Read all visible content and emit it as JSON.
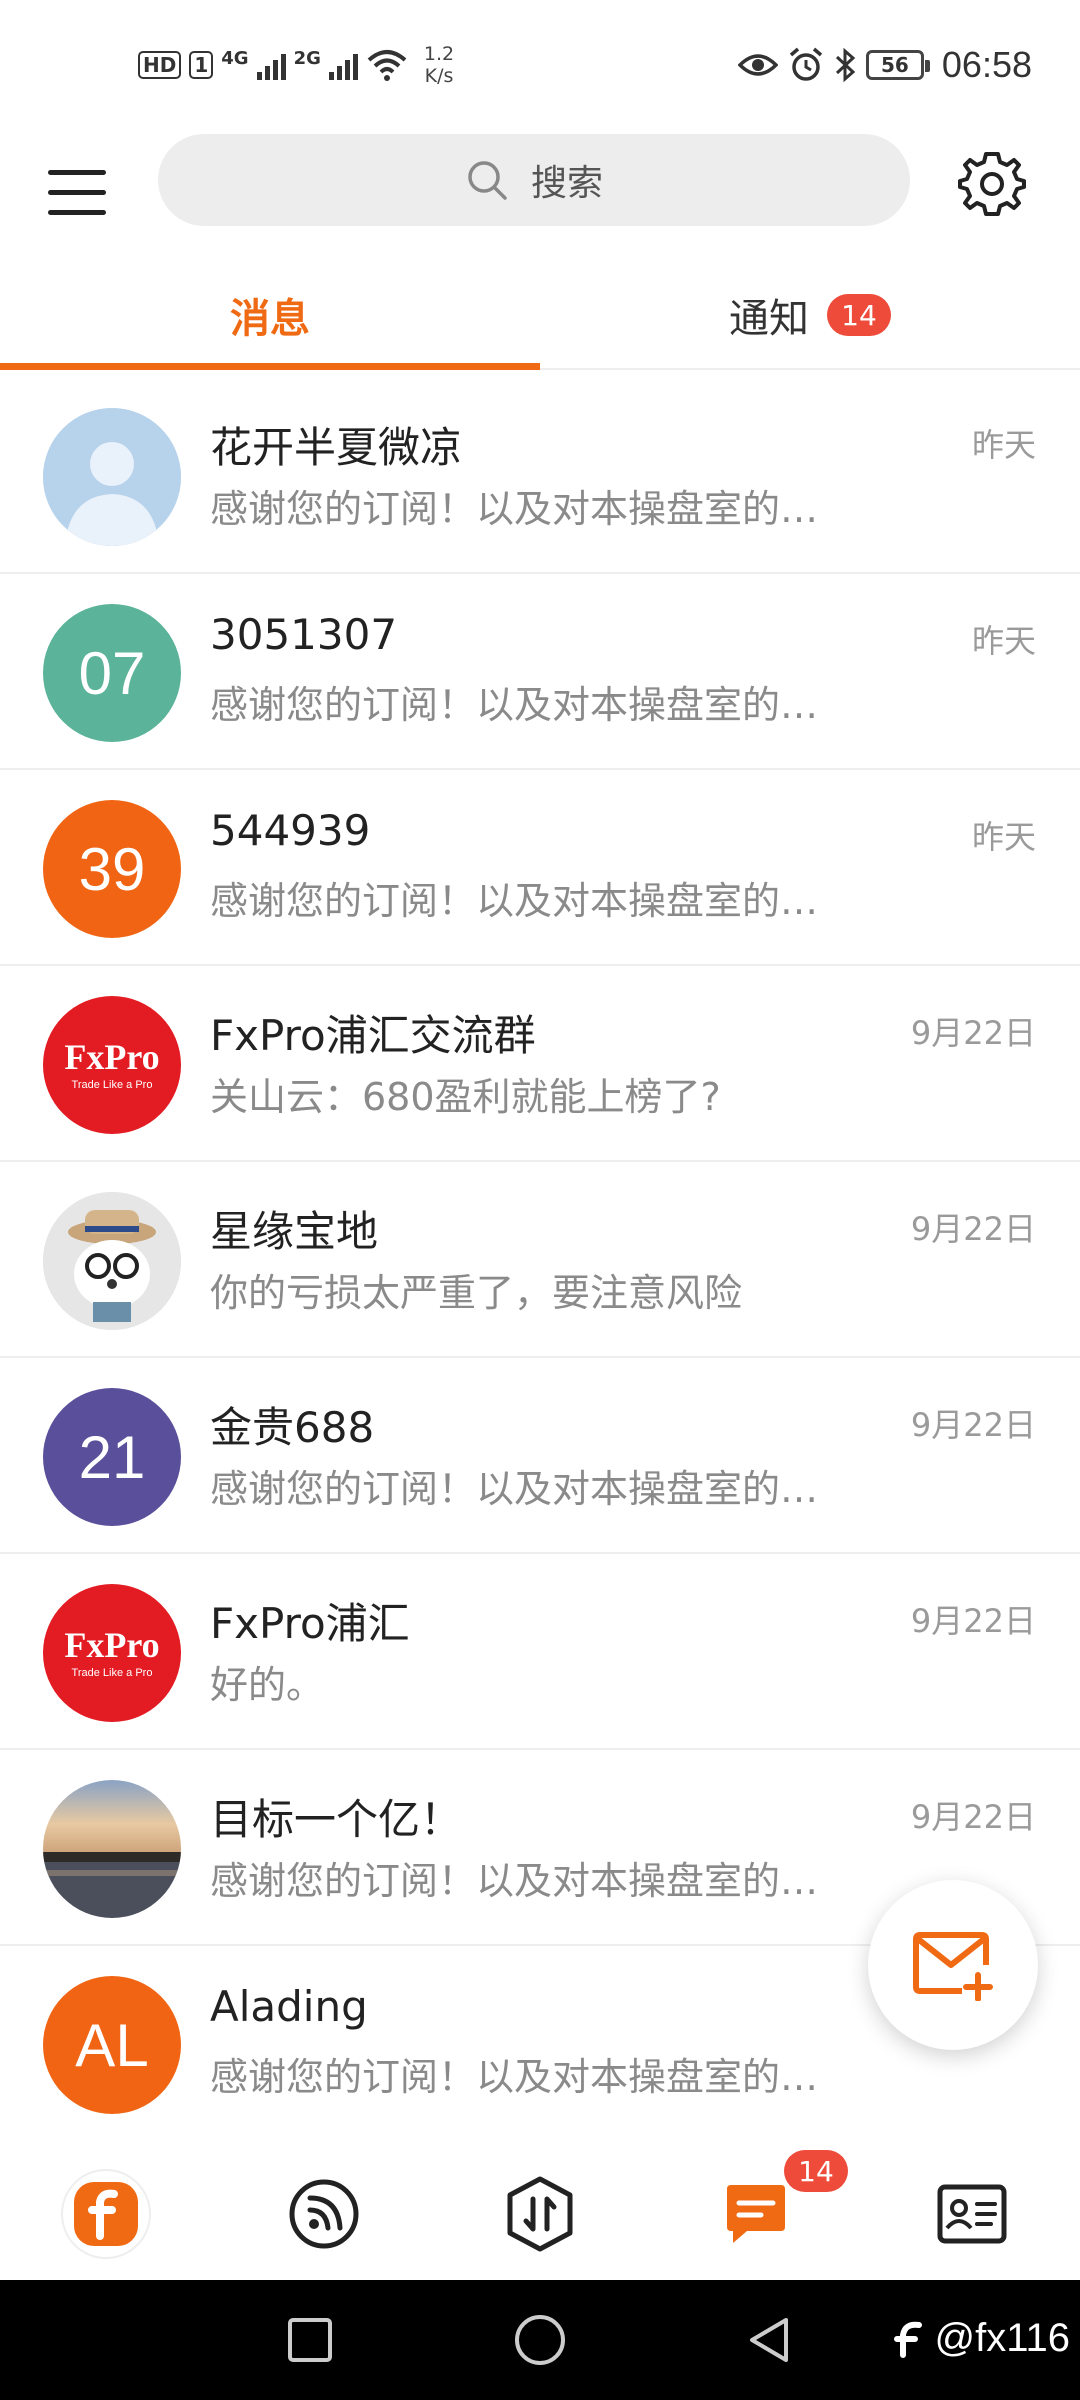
{
  "status_bar": {
    "hd_label": "HD",
    "sim_label": "1",
    "net1_label": "4G",
    "net2_label": "2G",
    "speed_value": "1.2",
    "speed_unit": "K/s",
    "battery": "56",
    "time": "06:58"
  },
  "search": {
    "placeholder": "搜索"
  },
  "tabs": {
    "messages": "消息",
    "notifications": "通知",
    "notifications_badge": "14"
  },
  "conversations": [
    {
      "name": "花开半夏微凉",
      "preview": "感谢您的订阅！以及对本操盘室的支持",
      "time": "昨天",
      "avatar": "default-person"
    },
    {
      "name": "3051307",
      "preview": "感谢您的订阅！以及对本操盘室的支持",
      "time": "昨天",
      "avatar_text": "07",
      "avatar_color": "#5bb39a"
    },
    {
      "name": "544939",
      "preview": "感谢您的订阅！以及对本操盘室的支持",
      "time": "昨天",
      "avatar_text": "39",
      "avatar_color": "#f06414"
    },
    {
      "name": "FxPro浦汇交流群",
      "preview": "关山云：680盈利就能上榜了?",
      "time": "9月22日",
      "avatar": "fxpro-logo"
    },
    {
      "name": "星缘宝地",
      "preview": "你的亏损太严重了，要注意风险",
      "time": "9月22日",
      "avatar": "dog-photo"
    },
    {
      "name": "金贵688",
      "preview": "感谢您的订阅！以及对本操盘室的支持",
      "time": "9月22日",
      "avatar_text": "21",
      "avatar_color": "#5a4f9a"
    },
    {
      "name": "FxPro浦汇",
      "preview": "好的。",
      "time": "9月22日",
      "avatar": "fxpro-logo"
    },
    {
      "name": "目标一个亿！",
      "preview": "感谢您的订阅！以及对本操盘室的支持",
      "time": "9月22日",
      "avatar": "sunset-photo"
    },
    {
      "name": "Alading",
      "preview": "感谢您的订阅！以及对本操盘室的支持",
      "time": "",
      "avatar_text": "AL",
      "avatar_color": "#f06414"
    }
  ],
  "fxpro_logo": {
    "text": "FxPro",
    "tagline": "Trade Like a Pro"
  },
  "bottom_nav": {
    "messages_badge": "14",
    "items": [
      "home-logo-icon",
      "feed-icon",
      "trade-icon",
      "messages-icon",
      "contact-card-icon"
    ]
  },
  "watermark": "@fx116",
  "colors": {
    "accent": "#f06a14",
    "badge": "#ee4b3a"
  }
}
